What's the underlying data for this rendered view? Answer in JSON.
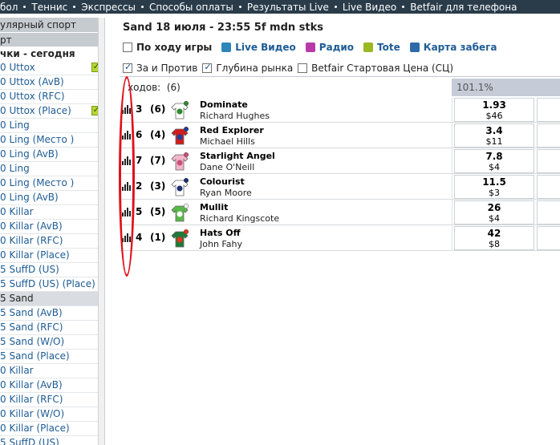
{
  "topnav": {
    "items": [
      "бол",
      "Теннис",
      "Экспрессы",
      "Способы оплаты",
      "Результаты Live",
      "Live Видео",
      "Betfair для телефона"
    ]
  },
  "sidebar": {
    "headers": [
      "улярный спорт",
      "рт"
    ],
    "group": "чки - сегодня",
    "rows": [
      {
        "label": "0 Uttox",
        "checked": true,
        "selected": false
      },
      {
        "label": "0 Uttox (AvB)",
        "checked": false,
        "selected": false
      },
      {
        "label": "0 Uttox (RFC)",
        "checked": false,
        "selected": false
      },
      {
        "label": "0 Uttox (Place)",
        "checked": true,
        "selected": false
      },
      {
        "label": "0 Ling",
        "checked": false,
        "selected": false
      },
      {
        "label": "0 Ling (Место )",
        "checked": false,
        "selected": false
      },
      {
        "label": "0 Ling (AvB)",
        "checked": false,
        "selected": false
      },
      {
        "label": "0 Ling",
        "checked": false,
        "selected": false
      },
      {
        "label": "0 Ling (Место )",
        "checked": false,
        "selected": false
      },
      {
        "label": "0 Ling (AvB)",
        "checked": false,
        "selected": false
      },
      {
        "label": "0 Killar",
        "checked": false,
        "selected": false
      },
      {
        "label": "0 Killar (AvB)",
        "checked": false,
        "selected": false
      },
      {
        "label": "0 Killar (RFC)",
        "checked": false,
        "selected": false
      },
      {
        "label": "0 Killar (Place)",
        "checked": false,
        "selected": false
      },
      {
        "label": "5 SuffD (US)",
        "checked": false,
        "selected": false
      },
      {
        "label": "5 SuffD (US) (Place)",
        "checked": false,
        "selected": false
      },
      {
        "label": "5 Sand",
        "checked": false,
        "selected": true
      },
      {
        "label": "5 Sand (AvB)",
        "checked": false,
        "selected": false
      },
      {
        "label": "5 Sand (RFC)",
        "checked": false,
        "selected": false
      },
      {
        "label": "5 Sand (W/O)",
        "checked": false,
        "selected": false
      },
      {
        "label": "5 Sand (Place)",
        "checked": false,
        "selected": false
      },
      {
        "label": "0 Killar",
        "checked": false,
        "selected": false
      },
      {
        "label": "0 Killar (AvB)",
        "checked": false,
        "selected": false
      },
      {
        "label": "0 Killar (RFC)",
        "checked": false,
        "selected": false
      },
      {
        "label": "0 Killar (W/O)",
        "checked": false,
        "selected": false
      },
      {
        "label": "0 Killar (Place)",
        "checked": false,
        "selected": false
      },
      {
        "label": "5 SuffD (US)",
        "checked": false,
        "selected": false
      }
    ]
  },
  "race": {
    "title": "Sand 18 июля - 23:55 5f mdn stks",
    "options": [
      {
        "label": "По ходу игры",
        "icon": "checkbox",
        "dark": true
      },
      {
        "label": "Live Видео",
        "icon": "tv-icon",
        "dark": false
      },
      {
        "label": "Радио",
        "icon": "radio-icon",
        "dark": false
      },
      {
        "label": "Tote",
        "icon": "tote-icon",
        "dark": false
      },
      {
        "label": "Карта забега",
        "icon": "racecard-icon",
        "dark": false
      }
    ],
    "filters": [
      {
        "label": "За и Против",
        "checked": true
      },
      {
        "label": "Глубина рынка",
        "checked": true
      },
      {
        "label": "Betfair Стартовая Цена (СЦ)",
        "checked": false
      }
    ],
    "runners_label": "ходов:",
    "runners_count": "(6)",
    "book_pct": "101.1%",
    "runners": [
      {
        "num": "3",
        "draw": "(6)",
        "name": "Dominate",
        "jockey": "Richard Hughes",
        "price": "1.93",
        "volume": "$46",
        "silk_main": "#ffffff",
        "silk_accent": "#2e8b2e"
      },
      {
        "num": "6",
        "draw": "(4)",
        "name": "Red Explorer",
        "jockey": "Michael Hills",
        "price": "3.4",
        "volume": "$11",
        "silk_main": "#d01c1c",
        "silk_accent": "#1f3f9a"
      },
      {
        "num": "7",
        "draw": "(7)",
        "name": "Starlight Angel",
        "jockey": "Dane O'Neill",
        "price": "7.8",
        "volume": "$4",
        "silk_main": "#f2b7c8",
        "silk_accent": "#cc4f7a"
      },
      {
        "num": "2",
        "draw": "(3)",
        "name": "Colourist",
        "jockey": "Ryan Moore",
        "price": "11.5",
        "volume": "$3",
        "silk_main": "#ffffff",
        "silk_accent": "#1c2f6e"
      },
      {
        "num": "5",
        "draw": "(5)",
        "name": "Mullit",
        "jockey": "Richard Kingscote",
        "price": "26",
        "volume": "$4",
        "silk_main": "#58b84a",
        "silk_accent": "#ffffff"
      },
      {
        "num": "4",
        "draw": "(1)",
        "name": "Hats Off",
        "jockey": "John Fahy",
        "price": "42",
        "volume": "$8",
        "silk_main": "#1f7a3a",
        "silk_accent": "#e2351a"
      }
    ]
  },
  "colors": {
    "topnav_bg": "#2a3c4a",
    "link": "#1e5c94",
    "annotation": "#e0101a"
  }
}
